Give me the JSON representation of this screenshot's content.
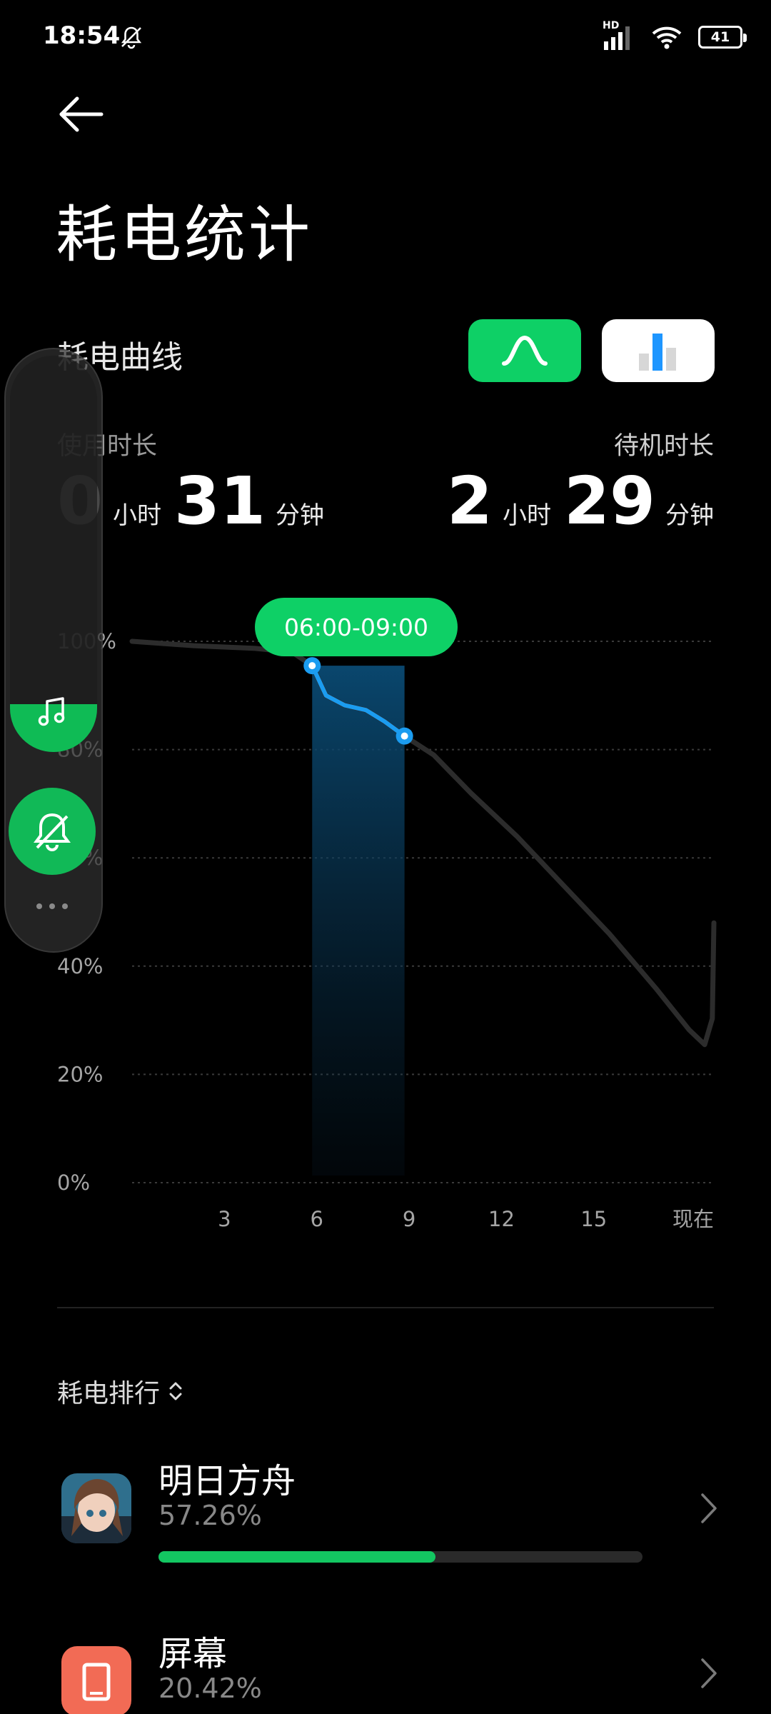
{
  "status_bar": {
    "time": "18:54",
    "network_badge": "HD",
    "battery_level": "41",
    "icons": [
      "bell-muted-icon",
      "signal-icon",
      "wifi-icon",
      "battery-icon"
    ]
  },
  "header": {
    "back_icon": "arrow-left-icon",
    "title": "耗电统计"
  },
  "curve_section": {
    "title": "耗电曲线",
    "view_toggles": [
      {
        "name": "curve-view",
        "icon": "curve-icon",
        "selected": true
      },
      {
        "name": "bar-view",
        "icon": "bar-chart-icon",
        "selected": false
      }
    ],
    "usage": {
      "label": "使用时长",
      "hours": "0",
      "hours_unit": "小时",
      "minutes": "31",
      "minutes_unit": "分钟"
    },
    "standby": {
      "label": "待机时长",
      "hours": "2",
      "hours_unit": "小时",
      "minutes": "29",
      "minutes_unit": "分钟"
    },
    "selected_range": "06:00-09:00"
  },
  "chart_data": {
    "type": "line",
    "y_tick_labels": [
      "100%",
      "80%",
      "60%",
      "40%",
      "20%",
      "0%"
    ],
    "x_tick_labels": [
      "3",
      "6",
      "9",
      "12",
      "15",
      "现在"
    ],
    "x_ticks": [
      3,
      6,
      9,
      12,
      15,
      18.9
    ],
    "ylim": [
      0,
      100
    ],
    "xlim": [
      0,
      18.9
    ],
    "grid": true,
    "highlight_range": [
      5.85,
      8.85
    ],
    "series": [
      {
        "values": [
          [
            0,
            100
          ],
          [
            2,
            99.2
          ],
          [
            4,
            98.7
          ],
          [
            5.2,
            98.0
          ],
          [
            5.85,
            95.5
          ],
          [
            6.3,
            90
          ],
          [
            6.9,
            88.2
          ],
          [
            7.6,
            87.3
          ],
          [
            8.2,
            85.2
          ],
          [
            8.85,
            82.5
          ],
          [
            9.8,
            79
          ],
          [
            11,
            72
          ],
          [
            12.5,
            64
          ],
          [
            14,
            55
          ],
          [
            15.5,
            46
          ],
          [
            17,
            36
          ],
          [
            18.1,
            28.2
          ],
          [
            18.6,
            25.5
          ],
          [
            18.85,
            30.3
          ],
          [
            18.9,
            48
          ]
        ]
      }
    ],
    "highlight_color": "#1b9cf0",
    "line_color": "#2c2c2c"
  },
  "ranking": {
    "title": "耗电排行",
    "sort_icon": "sort-updown-icon",
    "apps": [
      {
        "name": "明日方舟",
        "percent_text": "57.26%",
        "percent": 57.26
      },
      {
        "name": "屏幕",
        "percent_text": "20.42%",
        "percent": 20.42
      }
    ]
  },
  "floating_controls": {
    "volume_level": 12,
    "icons": [
      "music-note-icon",
      "bell-muted-icon",
      "more-dots-icon"
    ]
  },
  "colors": {
    "accent": "#0ed066",
    "highlight": "#1b9cf0",
    "screen_icon": "#f26b55"
  }
}
